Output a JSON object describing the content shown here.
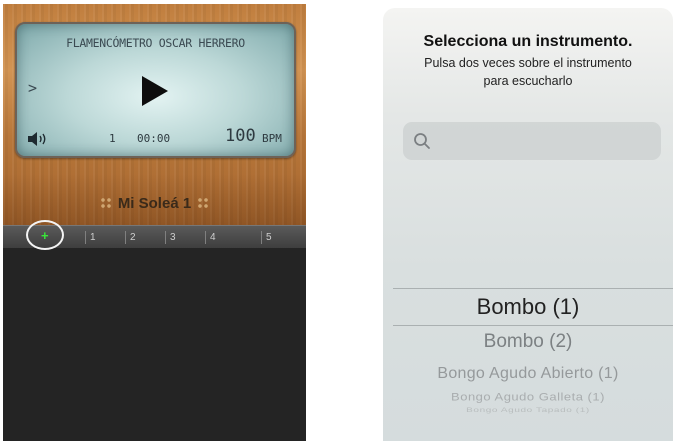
{
  "metronome": {
    "display_title": "FLAMENCÓMETRO OSCAR HERRERO",
    "chevron": ">",
    "measure": "1",
    "time": "00:00",
    "bpm_value": "100",
    "bpm_unit": "BPM",
    "pattern_name": "Mi Soleá 1",
    "ruler_ticks": [
      "1",
      "2",
      "3",
      "4",
      "5"
    ],
    "add_symbol": "+",
    "icons": {
      "play": "play-icon",
      "speaker": "speaker-icon",
      "add": "add-track-icon",
      "pattern_dots": "grip-dots-icon"
    },
    "colors": {
      "add_accent": "#39e639",
      "screen": "#bcd8d7",
      "wood": "#c07e3e"
    }
  },
  "picker": {
    "title": "Selecciona un instrumento.",
    "subtitle_line1": "Pulsa dos veces sobre el instrumento",
    "subtitle_line2": "para escucharlo",
    "search_placeholder": "",
    "selected_index": 0,
    "items": [
      "Bombo (1)",
      "Bombo (2)",
      "Bongo Agudo Abierto (1)",
      "Bongo Agudo Galleta (1)",
      "Bongo Agudo Tapado (1)"
    ],
    "icons": {
      "search": "search-icon"
    }
  }
}
